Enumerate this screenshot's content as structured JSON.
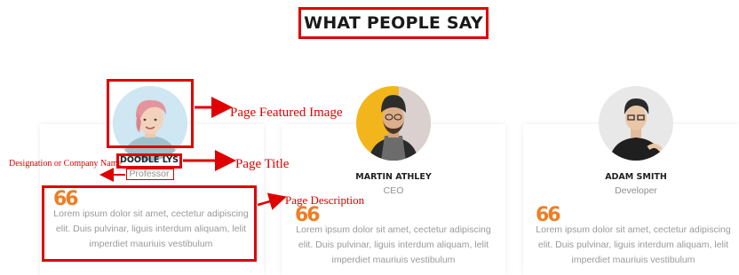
{
  "section": {
    "title": "WHAT PEOPLE SAY"
  },
  "testimonials": [
    {
      "name": "DOODLE LYS",
      "role": "Professor",
      "quote_mark": "66",
      "description": "Lorem ipsum dolor sit amet, cectetur adipiscing elit. Duis pulvinar, liguis interdum aliquam, lelit imperdiet mauriuis vestibulum"
    },
    {
      "name": "MARTIN ATHLEY",
      "role": "CEO",
      "quote_mark": "66",
      "description": "Lorem ipsum dolor sit amet, cectetur adipiscing elit. Duis pulvinar, liguis interdum aliquam, lelit imperdiet mauriuis vestibulum"
    },
    {
      "name": "ADAM SMITH",
      "role": "Developer",
      "quote_mark": "66",
      "description": "Lorem ipsum dolor sit amet, cectetur adipiscing elit. Duis pulvinar, liguis interdum aliquam, lelit imperdiet mauriuis vestibulum"
    }
  ],
  "annotations": {
    "featured_image": "Page Featured Image",
    "page_title": "Page Title",
    "designation": "Designation or Company Name",
    "description": "Page Description"
  },
  "colors": {
    "annotation": "#e00000",
    "quote": "#f07d22",
    "text_muted": "#9a9a9a"
  }
}
